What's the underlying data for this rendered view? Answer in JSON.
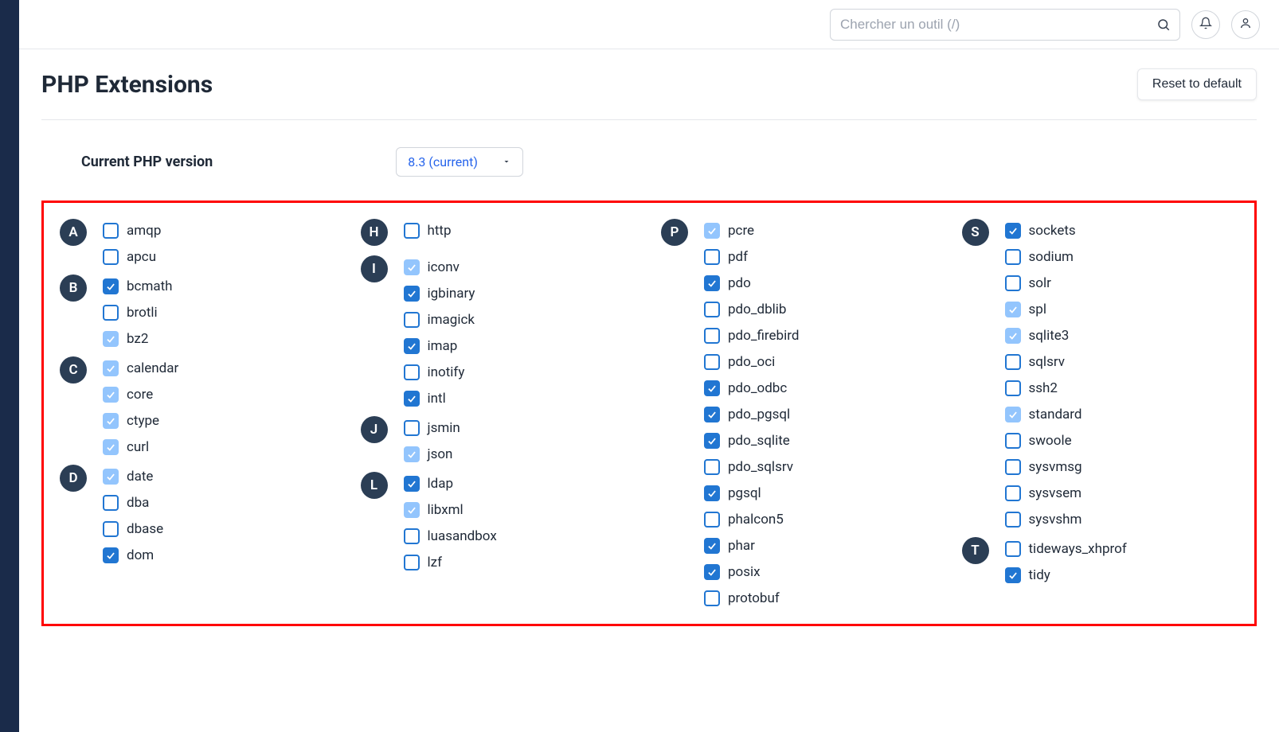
{
  "search": {
    "placeholder": "Chercher un outil (/)"
  },
  "page": {
    "title": "PHP Extensions",
    "reset_label": "Reset to default"
  },
  "version": {
    "label": "Current PHP version",
    "selected": "8.3 (current)"
  },
  "columns": [
    {
      "groups": [
        {
          "letter": "A",
          "items": [
            {
              "name": "amqp",
              "state": "unchecked"
            },
            {
              "name": "apcu",
              "state": "unchecked"
            }
          ]
        },
        {
          "letter": "B",
          "items": [
            {
              "name": "bcmath",
              "state": "checked"
            },
            {
              "name": "brotli",
              "state": "unchecked"
            },
            {
              "name": "bz2",
              "state": "checked-disabled"
            }
          ]
        },
        {
          "letter": "C",
          "items": [
            {
              "name": "calendar",
              "state": "checked-disabled"
            },
            {
              "name": "core",
              "state": "checked-disabled"
            },
            {
              "name": "ctype",
              "state": "checked-disabled"
            },
            {
              "name": "curl",
              "state": "checked-disabled"
            }
          ]
        },
        {
          "letter": "D",
          "items": [
            {
              "name": "date",
              "state": "checked-disabled"
            },
            {
              "name": "dba",
              "state": "unchecked"
            },
            {
              "name": "dbase",
              "state": "unchecked"
            },
            {
              "name": "dom",
              "state": "checked"
            }
          ]
        }
      ]
    },
    {
      "groups": [
        {
          "letter": "H",
          "items": [
            {
              "name": "http",
              "state": "unchecked"
            }
          ]
        },
        {
          "letter": "I",
          "items": [
            {
              "name": "iconv",
              "state": "checked-disabled"
            },
            {
              "name": "igbinary",
              "state": "checked"
            },
            {
              "name": "imagick",
              "state": "unchecked"
            },
            {
              "name": "imap",
              "state": "checked"
            },
            {
              "name": "inotify",
              "state": "unchecked"
            },
            {
              "name": "intl",
              "state": "checked"
            }
          ]
        },
        {
          "letter": "J",
          "items": [
            {
              "name": "jsmin",
              "state": "unchecked"
            },
            {
              "name": "json",
              "state": "checked-disabled"
            }
          ]
        },
        {
          "letter": "L",
          "items": [
            {
              "name": "ldap",
              "state": "checked"
            },
            {
              "name": "libxml",
              "state": "checked-disabled"
            },
            {
              "name": "luasandbox",
              "state": "unchecked"
            },
            {
              "name": "lzf",
              "state": "unchecked"
            }
          ]
        }
      ]
    },
    {
      "groups": [
        {
          "letter": "P",
          "items": [
            {
              "name": "pcre",
              "state": "checked-disabled"
            },
            {
              "name": "pdf",
              "state": "unchecked"
            },
            {
              "name": "pdo",
              "state": "checked"
            },
            {
              "name": "pdo_dblib",
              "state": "unchecked"
            },
            {
              "name": "pdo_firebird",
              "state": "unchecked"
            },
            {
              "name": "pdo_oci",
              "state": "unchecked"
            },
            {
              "name": "pdo_odbc",
              "state": "checked"
            },
            {
              "name": "pdo_pgsql",
              "state": "checked"
            },
            {
              "name": "pdo_sqlite",
              "state": "checked"
            },
            {
              "name": "pdo_sqlsrv",
              "state": "unchecked"
            },
            {
              "name": "pgsql",
              "state": "checked"
            },
            {
              "name": "phalcon5",
              "state": "unchecked"
            },
            {
              "name": "phar",
              "state": "checked"
            },
            {
              "name": "posix",
              "state": "checked"
            },
            {
              "name": "protobuf",
              "state": "unchecked"
            }
          ]
        }
      ]
    },
    {
      "groups": [
        {
          "letter": "S",
          "items": [
            {
              "name": "sockets",
              "state": "checked"
            },
            {
              "name": "sodium",
              "state": "unchecked"
            },
            {
              "name": "solr",
              "state": "unchecked"
            },
            {
              "name": "spl",
              "state": "checked-disabled"
            },
            {
              "name": "sqlite3",
              "state": "checked-disabled"
            },
            {
              "name": "sqlsrv",
              "state": "unchecked"
            },
            {
              "name": "ssh2",
              "state": "unchecked"
            },
            {
              "name": "standard",
              "state": "checked-disabled"
            },
            {
              "name": "swoole",
              "state": "unchecked"
            },
            {
              "name": "sysvmsg",
              "state": "unchecked"
            },
            {
              "name": "sysvsem",
              "state": "unchecked"
            },
            {
              "name": "sysvshm",
              "state": "unchecked"
            }
          ]
        },
        {
          "letter": "T",
          "items": [
            {
              "name": "tideways_xhprof",
              "state": "unchecked"
            },
            {
              "name": "tidy",
              "state": "checked"
            }
          ]
        }
      ]
    }
  ]
}
